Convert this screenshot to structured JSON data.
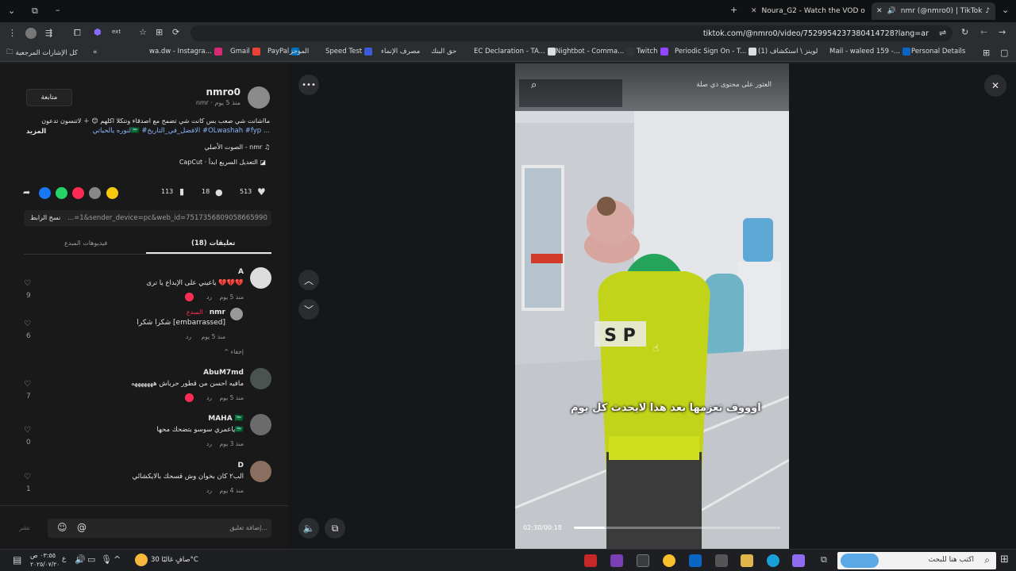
{
  "tabs": {
    "tab1_title": "Noura_G2 - Watch the VOD on",
    "tab2_title": "nmr (@nmro0) | TikTok"
  },
  "toolbar": {
    "url": "tiktok.com/@nmro0/video/7529954237380414728?lang=ar"
  },
  "bookmarks": [
    {
      "label": "كل الإشارات المرجعية"
    },
    {
      "label": "wa.dw - Instagra..."
    },
    {
      "label": "Gmail"
    },
    {
      "label": "PayPal"
    },
    {
      "label": "الموجز"
    },
    {
      "label": "Speed Test"
    },
    {
      "label": "مصرف الإنماء"
    },
    {
      "label": "حق البنك"
    },
    {
      "label": "EC Declaration - TA..."
    },
    {
      "label": "Nightbot - Comma..."
    },
    {
      "label": "Twitch"
    },
    {
      "label": "Periodic Sign On - T..."
    },
    {
      "label": "(1) لوينز \\ استكشاف"
    },
    {
      "label": "Mail - waleed 159 -..."
    },
    {
      "label": "Personal Details"
    }
  ],
  "post": {
    "username": "nmro0",
    "meta": "nmr · منذ 5 يوم",
    "follow_label": "متابعة",
    "caption_line1": "مااشانت شي صعب بس كانت شي تضمح مع اصدقاء ونتكلا اكلهم 😊 ＋ لاتنسون تدعون",
    "caption_line2": "لنوره يالحياتي🇸🇦 #الافضل_في_التاريخ #OLwashah #fyp ...",
    "more_label": "المزيد",
    "sound": "الصوت الأصلي - nmr",
    "capcut": "CapCut · التعديل السريع ابدأ",
    "likes": "513",
    "comments": "18",
    "saves": "113",
    "link_text": "...=1&sender_device=pc&web_id=7517356809058665990",
    "copy_link": "نسخ الرابط",
    "tab_comments": "(18) تعليقات",
    "tab_creator": "فيديوهات المبدع"
  },
  "comments": [
    {
      "user": "A",
      "text": "ياعيني على الإبداع يا ترى 💔💔💔",
      "time": "منذ 5 يوم",
      "reply": "رد",
      "likes": "9"
    },
    {
      "user": "nmr",
      "tag": "المبدع ·",
      "text": "شكرا شكرا [embarrassed]",
      "time": "منذ 5 يوم",
      "reply": "رد",
      "likes": "6",
      "hide": "إخفاء"
    },
    {
      "user": "AbuM7md",
      "text": "مافيه احسن من قطور حرباش هههههههه",
      "time": "منذ 5 يوم",
      "reply": "رد",
      "likes": "7"
    },
    {
      "user": "MAHA 🇸🇦",
      "text": "ياعمري سوسو بتضحك محها🇸🇦",
      "time": "منذ 3 يوم",
      "reply": "رد",
      "likes": "0"
    },
    {
      "user": "D",
      "text": "الب٢ كان بخوان وش قسحك بالايكشائي",
      "time": "منذ 4 يوم",
      "reply": "رد",
      "likes": "1"
    }
  ],
  "comment_input": {
    "placeholder": "إضافة تعليق...",
    "post_label": "نشر"
  },
  "video": {
    "search_placeholder": "العثور على محتوى ذي صلة",
    "subtitle": "اوووف تعزمها بعد هذا لايحدث كل يوم",
    "time": "02:30/00:18",
    "progress": 0.15
  },
  "taskbar": {
    "search_placeholder": "اكتب هنا للبحث",
    "weather": "صافٍ غالبًا 30°C",
    "clock_time": "٠٣:٥٥ ص",
    "clock_date": "٢٠٢٥/٠٧/٢٠"
  }
}
